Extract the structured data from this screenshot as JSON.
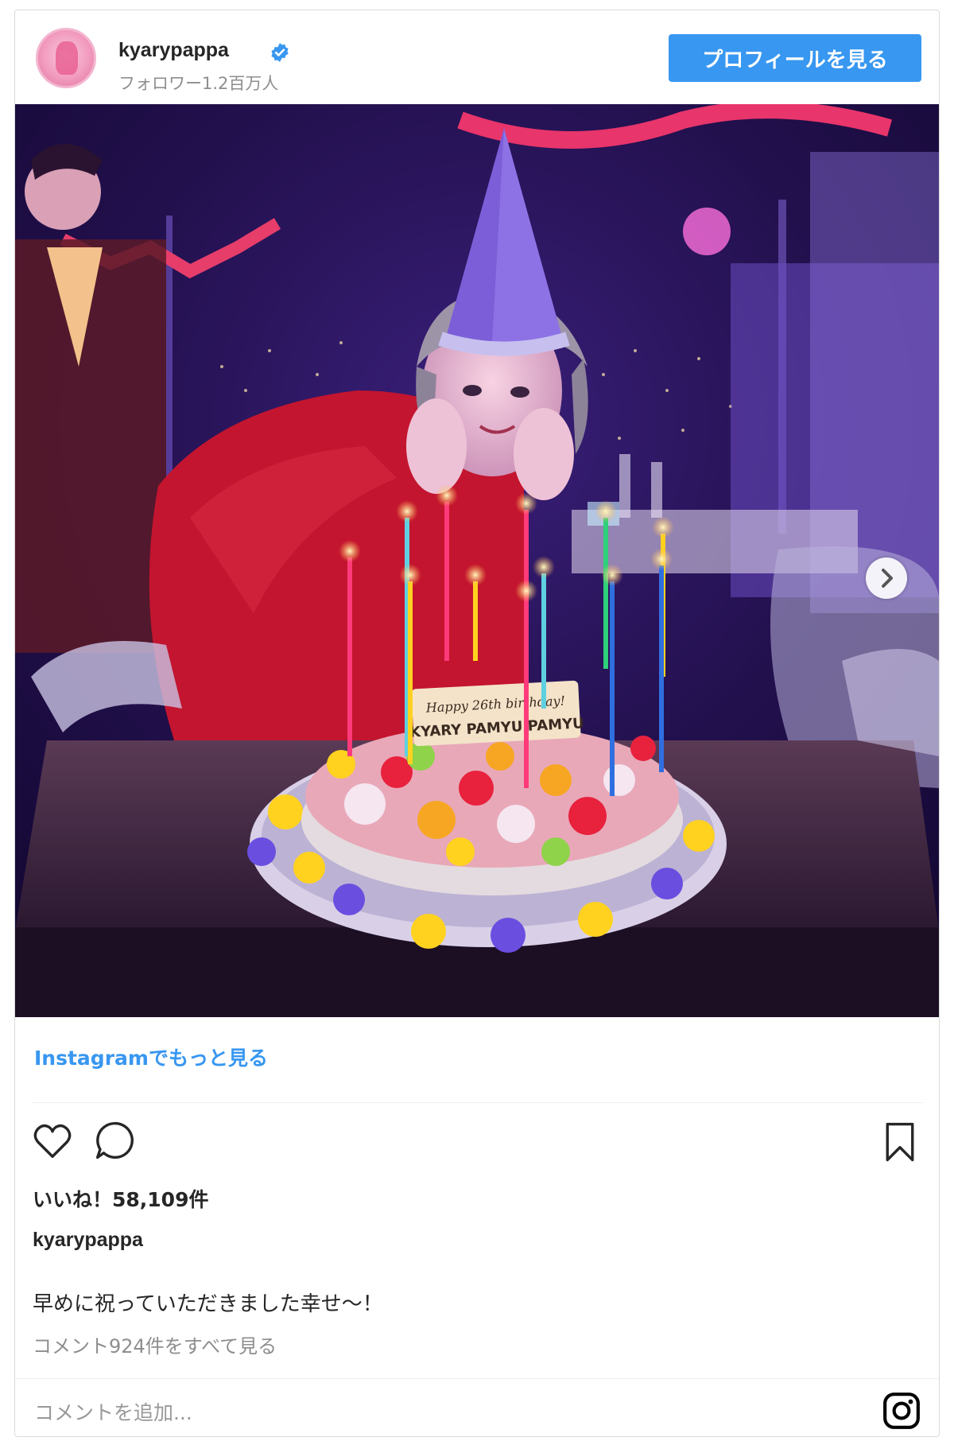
{
  "header": {
    "username": "kyarypappa",
    "followers": "フォロワー1.2百万人",
    "profile_button": "プロフィールを見る",
    "verified_color": "#3897f0"
  },
  "photo": {
    "cake_plaque_line1": "Happy 26th birthday!",
    "cake_plaque_line2": "KYARY PAMYU PAMYU"
  },
  "links": {
    "more_on_instagram": "Instagramでもっと見る"
  },
  "actions": {
    "like_icon": "heart-icon",
    "comment_icon": "comment-icon",
    "save_icon": "bookmark-icon"
  },
  "post": {
    "likes": "いいね！58,109件",
    "caption_user": "kyarypappa",
    "caption": "早めに祝っていただきました幸せ〜！",
    "view_comments": "コメント924件をすべて見る"
  },
  "comment_box": {
    "placeholder": "コメントを追加..."
  },
  "colors": {
    "accent": "#3897f0",
    "text": "#262626",
    "muted": "#8e8e8e"
  }
}
